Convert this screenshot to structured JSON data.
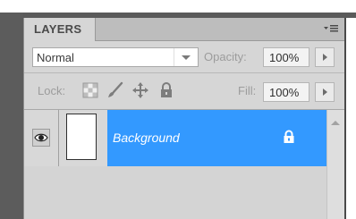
{
  "panel": {
    "tab_label": "LAYERS",
    "menu_icon": "panel-menu-icon"
  },
  "blend": {
    "mode": "Normal",
    "opacity_label": "Opacity:",
    "opacity_value": "100%"
  },
  "lock": {
    "label": "Lock:",
    "icons": [
      "lock-transparent-pixels-icon",
      "lock-image-pixels-icon",
      "lock-position-icon",
      "lock-all-icon"
    ],
    "fill_label": "Fill:",
    "fill_value": "100%"
  },
  "layers": [
    {
      "name": "Background",
      "visible": true,
      "locked": true,
      "selected": true
    }
  ],
  "colors": {
    "selected_layer": "#3399ff",
    "panel_bg": "#d6d6d6"
  }
}
